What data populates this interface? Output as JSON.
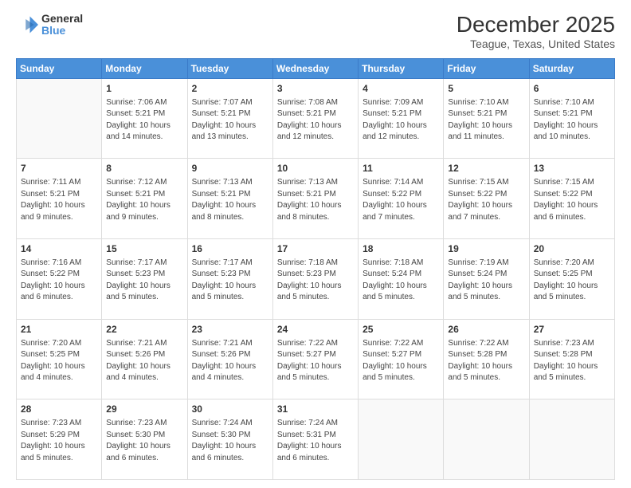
{
  "logo": {
    "line1": "General",
    "line2": "Blue"
  },
  "title": "December 2025",
  "subtitle": "Teague, Texas, United States",
  "weekdays": [
    "Sunday",
    "Monday",
    "Tuesday",
    "Wednesday",
    "Thursday",
    "Friday",
    "Saturday"
  ],
  "weeks": [
    [
      {
        "day": "",
        "info": ""
      },
      {
        "day": "1",
        "info": "Sunrise: 7:06 AM\nSunset: 5:21 PM\nDaylight: 10 hours\nand 14 minutes."
      },
      {
        "day": "2",
        "info": "Sunrise: 7:07 AM\nSunset: 5:21 PM\nDaylight: 10 hours\nand 13 minutes."
      },
      {
        "day": "3",
        "info": "Sunrise: 7:08 AM\nSunset: 5:21 PM\nDaylight: 10 hours\nand 12 minutes."
      },
      {
        "day": "4",
        "info": "Sunrise: 7:09 AM\nSunset: 5:21 PM\nDaylight: 10 hours\nand 12 minutes."
      },
      {
        "day": "5",
        "info": "Sunrise: 7:10 AM\nSunset: 5:21 PM\nDaylight: 10 hours\nand 11 minutes."
      },
      {
        "day": "6",
        "info": "Sunrise: 7:10 AM\nSunset: 5:21 PM\nDaylight: 10 hours\nand 10 minutes."
      }
    ],
    [
      {
        "day": "7",
        "info": "Sunrise: 7:11 AM\nSunset: 5:21 PM\nDaylight: 10 hours\nand 9 minutes."
      },
      {
        "day": "8",
        "info": "Sunrise: 7:12 AM\nSunset: 5:21 PM\nDaylight: 10 hours\nand 9 minutes."
      },
      {
        "day": "9",
        "info": "Sunrise: 7:13 AM\nSunset: 5:21 PM\nDaylight: 10 hours\nand 8 minutes."
      },
      {
        "day": "10",
        "info": "Sunrise: 7:13 AM\nSunset: 5:21 PM\nDaylight: 10 hours\nand 8 minutes."
      },
      {
        "day": "11",
        "info": "Sunrise: 7:14 AM\nSunset: 5:22 PM\nDaylight: 10 hours\nand 7 minutes."
      },
      {
        "day": "12",
        "info": "Sunrise: 7:15 AM\nSunset: 5:22 PM\nDaylight: 10 hours\nand 7 minutes."
      },
      {
        "day": "13",
        "info": "Sunrise: 7:15 AM\nSunset: 5:22 PM\nDaylight: 10 hours\nand 6 minutes."
      }
    ],
    [
      {
        "day": "14",
        "info": "Sunrise: 7:16 AM\nSunset: 5:22 PM\nDaylight: 10 hours\nand 6 minutes."
      },
      {
        "day": "15",
        "info": "Sunrise: 7:17 AM\nSunset: 5:23 PM\nDaylight: 10 hours\nand 5 minutes."
      },
      {
        "day": "16",
        "info": "Sunrise: 7:17 AM\nSunset: 5:23 PM\nDaylight: 10 hours\nand 5 minutes."
      },
      {
        "day": "17",
        "info": "Sunrise: 7:18 AM\nSunset: 5:23 PM\nDaylight: 10 hours\nand 5 minutes."
      },
      {
        "day": "18",
        "info": "Sunrise: 7:18 AM\nSunset: 5:24 PM\nDaylight: 10 hours\nand 5 minutes."
      },
      {
        "day": "19",
        "info": "Sunrise: 7:19 AM\nSunset: 5:24 PM\nDaylight: 10 hours\nand 5 minutes."
      },
      {
        "day": "20",
        "info": "Sunrise: 7:20 AM\nSunset: 5:25 PM\nDaylight: 10 hours\nand 5 minutes."
      }
    ],
    [
      {
        "day": "21",
        "info": "Sunrise: 7:20 AM\nSunset: 5:25 PM\nDaylight: 10 hours\nand 4 minutes."
      },
      {
        "day": "22",
        "info": "Sunrise: 7:21 AM\nSunset: 5:26 PM\nDaylight: 10 hours\nand 4 minutes."
      },
      {
        "day": "23",
        "info": "Sunrise: 7:21 AM\nSunset: 5:26 PM\nDaylight: 10 hours\nand 4 minutes."
      },
      {
        "day": "24",
        "info": "Sunrise: 7:22 AM\nSunset: 5:27 PM\nDaylight: 10 hours\nand 5 minutes."
      },
      {
        "day": "25",
        "info": "Sunrise: 7:22 AM\nSunset: 5:27 PM\nDaylight: 10 hours\nand 5 minutes."
      },
      {
        "day": "26",
        "info": "Sunrise: 7:22 AM\nSunset: 5:28 PM\nDaylight: 10 hours\nand 5 minutes."
      },
      {
        "day": "27",
        "info": "Sunrise: 7:23 AM\nSunset: 5:28 PM\nDaylight: 10 hours\nand 5 minutes."
      }
    ],
    [
      {
        "day": "28",
        "info": "Sunrise: 7:23 AM\nSunset: 5:29 PM\nDaylight: 10 hours\nand 5 minutes."
      },
      {
        "day": "29",
        "info": "Sunrise: 7:23 AM\nSunset: 5:30 PM\nDaylight: 10 hours\nand 6 minutes."
      },
      {
        "day": "30",
        "info": "Sunrise: 7:24 AM\nSunset: 5:30 PM\nDaylight: 10 hours\nand 6 minutes."
      },
      {
        "day": "31",
        "info": "Sunrise: 7:24 AM\nSunset: 5:31 PM\nDaylight: 10 hours\nand 6 minutes."
      },
      {
        "day": "",
        "info": ""
      },
      {
        "day": "",
        "info": ""
      },
      {
        "day": "",
        "info": ""
      }
    ]
  ]
}
